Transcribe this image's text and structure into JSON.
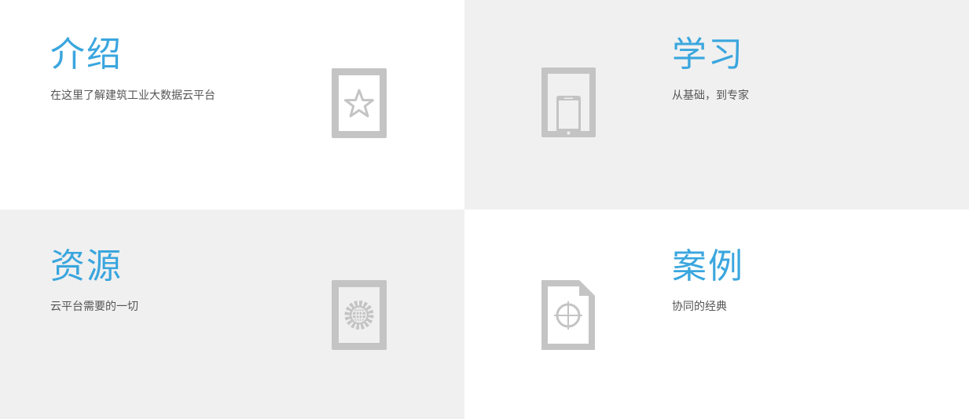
{
  "tiles": [
    {
      "title": "介绍",
      "subtitle": "在这里了解建筑工业大数据云平台",
      "icon": "star-tablet-icon"
    },
    {
      "title": "学习",
      "subtitle": "从基础，到专家",
      "icon": "mobile-tablet-icon"
    },
    {
      "title": "资源",
      "subtitle": "云平台需要的一切",
      "icon": "globe-gear-icon"
    },
    {
      "title": "案例",
      "subtitle": "协同的经典",
      "icon": "target-document-icon"
    }
  ],
  "colors": {
    "title": "#3aa6de",
    "text": "#555555",
    "icon": "#c4c4c4",
    "tile_alt": "#f0f0f0"
  }
}
